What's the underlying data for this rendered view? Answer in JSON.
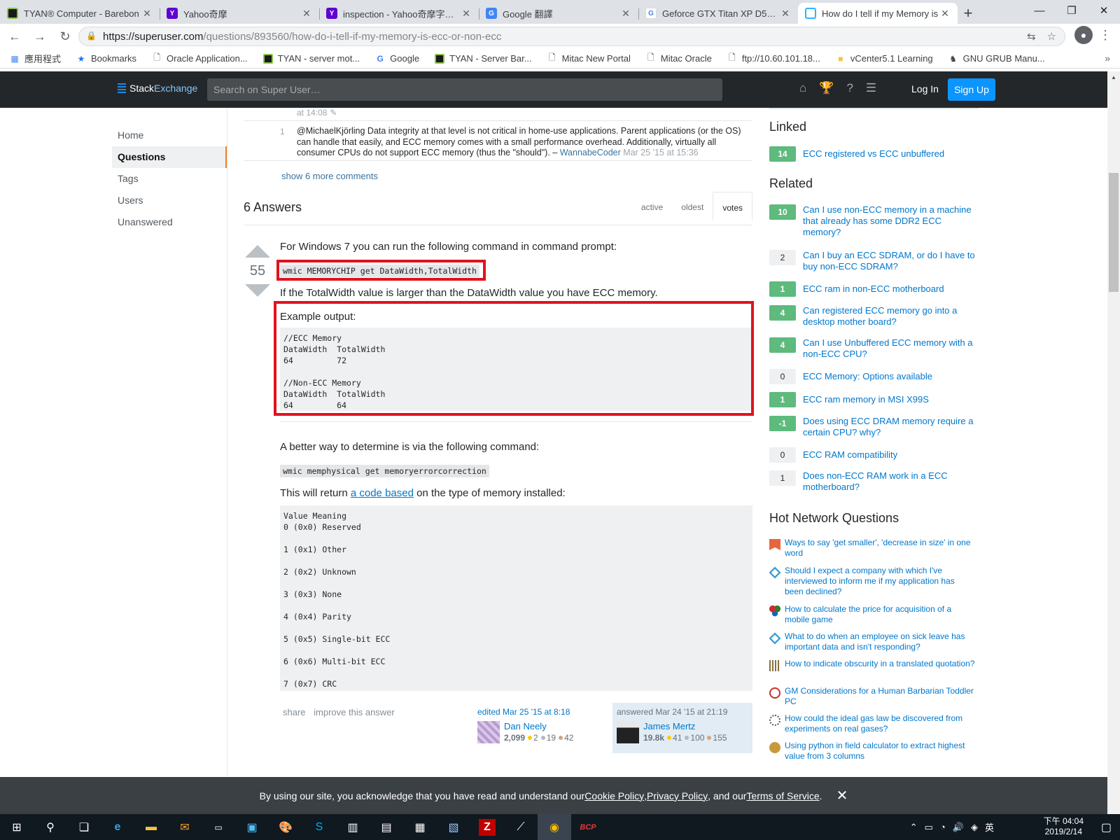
{
  "browser": {
    "tabs": [
      {
        "label": "TYAN® Computer - Barebon",
        "fav_color": "#1a1a1a",
        "fav_text": "",
        "active": false
      },
      {
        "label": "Yahoo奇摩",
        "fav_color": "#5f01d1",
        "fav_text": "Y",
        "active": false
      },
      {
        "label": "inspection - Yahoo奇摩字典 搜",
        "fav_color": "#5f01d1",
        "fav_text": "Y",
        "active": false
      },
      {
        "label": "Google 翻譯",
        "fav_color": "#4285f4",
        "fav_text": "G",
        "active": false
      },
      {
        "label": "Geforce GTX Titan XP D5X 12",
        "fav_color": "#ffffff",
        "fav_text": "G",
        "active": false
      },
      {
        "label": "How do I tell if my Memory is",
        "fav_color": "#ffffff",
        "fav_text": "",
        "active": true
      }
    ],
    "url_host": "https://superuser.com",
    "url_path": "/questions/893560/how-do-i-tell-if-my-memory-is-ecc-or-non-ecc",
    "bookmarks": [
      {
        "label": "應用程式",
        "icon": "apps-grid-icon"
      },
      {
        "label": "Bookmarks",
        "icon": "star-icon"
      },
      {
        "label": "Oracle Application...",
        "icon": "page-icon"
      },
      {
        "label": "TYAN - server mot...",
        "icon": "tyan-icon"
      },
      {
        "label": "Google",
        "icon": "google-icon"
      },
      {
        "label": "TYAN - Server Bar...",
        "icon": "tyan-icon"
      },
      {
        "label": "Mitac New Portal",
        "icon": "page-icon"
      },
      {
        "label": "Mitac Oracle",
        "icon": "page-icon"
      },
      {
        "label": "ftp://10.60.101.18...",
        "icon": "page-icon"
      },
      {
        "label": "vCenter5.1 Learning",
        "icon": "folder-icon"
      },
      {
        "label": "GNU GRUB Manu...",
        "icon": "gnu-icon"
      }
    ]
  },
  "header": {
    "logo_stack": "Stack",
    "logo_exchange": "Exchange",
    "search_placeholder": "Search on Super User…",
    "login": "Log In",
    "signup": "Sign Up"
  },
  "left_nav": {
    "home": "Home",
    "questions": "Questions",
    "tags": "Tags",
    "users": "Users",
    "unanswered": "Unanswered"
  },
  "comments": {
    "prev_time": "at 14:08",
    "score": "1",
    "text": "@MichaelKjörling Data integrity at that level is not critical in home-use applications. Parent applications (or the OS) can handle that easily, and ECC memory comes with a small performance overhead. Additionally, virtually all consumer CPUs do not support ECC memory (thus the \"should\"). – ",
    "user": "WannabeCoder",
    "date": "Mar 25 '15 at 15:36",
    "show_more": "show 6 more comments"
  },
  "answers": {
    "count_label": "6 Answers",
    "sort_tabs": [
      "active",
      "oldest",
      "votes"
    ],
    "active_sort": "votes"
  },
  "answer": {
    "votes": "55",
    "p1": "For Windows 7 you can run the following command in command prompt:",
    "code1": "wmic MEMORYCHIP get DataWidth,TotalWidth",
    "p2": "If the TotalWidth value is larger than the DataWidth value you have ECC memory.",
    "p3": "Example output:",
    "code2": "//ECC Memory\nDataWidth  TotalWidth\n64         72\n\n//Non-ECC Memory\nDataWidth  TotalWidth\n64         64",
    "p4": "A better way to determine is via the following command:",
    "code3": "wmic memphysical get memoryerrorcorrection",
    "p5_before": "This will return ",
    "p5_link": "a code based",
    "p5_after": " on the type of memory installed:",
    "code4": "Value Meaning\n0 (0x0) Reserved\n\n1 (0x1) Other\n\n2 (0x2) Unknown\n\n3 (0x3) None\n\n4 (0x4) Parity\n\n5 (0x5) Single-bit ECC\n\n6 (0x6) Multi-bit ECC\n\n7 (0x7) CRC",
    "share": "share",
    "improve": "improve this answer",
    "edited": "edited Mar 25 '15 at 8:18",
    "editor": {
      "name": "Dan Neely",
      "rep": "2,099",
      "gold": "2",
      "silver": "19",
      "bronze": "42"
    },
    "answered": "answered Mar 24 '15 at 21:19",
    "author": {
      "name": "James Mertz",
      "rep": "19.8k",
      "gold": "41",
      "silver": "100",
      "bronze": "155"
    }
  },
  "sidebar": {
    "linked_title": "Linked",
    "linked": [
      {
        "score": "14",
        "title": "ECC registered vs ECC unbuffered"
      }
    ],
    "related_title": "Related",
    "related": [
      {
        "score": "10",
        "title": "Can I use non-ECC memory in a machine that already has some DDR2 ECC memory?"
      },
      {
        "score": "2",
        "title": "Can I buy an ECC SDRAM, or do I have to buy non-ECC SDRAM?"
      },
      {
        "score": "1",
        "title": "ECC ram in non-ECC motherboard"
      },
      {
        "score": "4",
        "title": "Can registered ECC memory go into a desktop mother board?"
      },
      {
        "score": "4",
        "title": "Can I use Unbuffered ECC memory with a non-ECC CPU?"
      },
      {
        "score": "0",
        "title": "ECC Memory: Options available"
      },
      {
        "score": "1",
        "title": "ECC ram memory in MSI X99S"
      },
      {
        "score": "-1",
        "title": "Does using ECC DRAM memory require a certain CPU? why?"
      },
      {
        "score": "0",
        "title": "ECC RAM compatibility"
      },
      {
        "score": "1",
        "title": "Does non-ECC RAM work in a ECC motherboard?"
      }
    ],
    "hot_title": "Hot Network Questions",
    "hot": [
      {
        "title": "Ways to say 'get smaller', 'decrease in size' in one word",
        "icon_color": "#e8663d"
      },
      {
        "title": "Should I expect a company with which I've interviewed to inform me if my application has been declined?",
        "icon_color": "#3a9bd8"
      },
      {
        "title": "How to calculate the price for acquisition of a mobile game",
        "icon_color": "#c9302c"
      },
      {
        "title": "What to do when an employee on sick leave has important data and isn't responding?",
        "icon_color": "#3a9bd8"
      },
      {
        "title": "How to indicate obscurity in a translated quotation?",
        "icon_color": "#8a6d3b"
      },
      {
        "title": "GM Considerations for a Human Barbarian Toddler PC",
        "icon_color": "#c9302c"
      },
      {
        "title": "How could the ideal gas law be discovered from experiments on real gases?",
        "icon_color": "#555555"
      },
      {
        "title": "Using python in field calculator to extract highest value from 3 columns",
        "icon_color": "#c79a3b"
      }
    ]
  },
  "cookie": {
    "text_before": "By using our site, you acknowledge that you have read and understand our ",
    "cookie_policy": "Cookie Policy",
    "sep1": ", ",
    "privacy_policy": "Privacy Policy",
    "sep2": ", and our ",
    "terms": "Terms of Service",
    "end": "."
  },
  "taskbar": {
    "ime": "英",
    "time": "下午 04:04",
    "date": "2019/2/14"
  }
}
